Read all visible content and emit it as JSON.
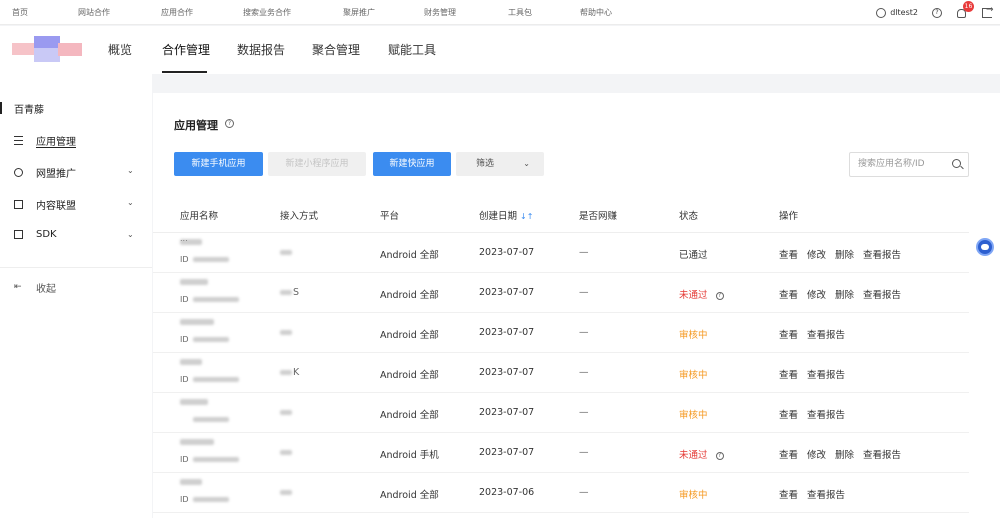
{
  "topnav": [
    "首页",
    "网站合作",
    "应用合作",
    "搜索业务合作",
    "聚屏推广",
    "财务管理",
    "工具包",
    "帮助中心"
  ],
  "user": {
    "name": "dltest2",
    "badge": "16"
  },
  "subnav": [
    "概览",
    "合作管理",
    "数据报告",
    "聚合管理",
    "赋能工具"
  ],
  "sidebar": {
    "title": "百青藤",
    "items": [
      {
        "label": "应用管理",
        "icon": "list-icon"
      },
      {
        "label": "网盟推广",
        "icon": "target-icon"
      },
      {
        "label": "内容联盟",
        "icon": "image-icon"
      },
      {
        "label": "SDK",
        "icon": "sdk-icon"
      }
    ],
    "collapse": "收起"
  },
  "main": {
    "heading": "应用管理",
    "buttons": {
      "new_mobile": "新建手机应用",
      "new_miniprogram": "新建小程序应用",
      "new_quickapp": "新建快应用",
      "filter": "筛选"
    },
    "search_placeholder": "搜索应用名称/ID",
    "columns": [
      "应用名称",
      "接入方式",
      "平台",
      "创建日期",
      "是否网赚",
      "状态",
      "操作"
    ],
    "rows": [
      {
        "name": "...",
        "id": "ID",
        "access": "",
        "platform": "Android 全部",
        "date": "2023-07-07",
        "earn": "—",
        "status": "已通过",
        "status_kind": "ok",
        "ops": [
          "查看",
          "修改",
          "删除",
          "查看报告"
        ]
      },
      {
        "name": "",
        "id": "ID",
        "access": "S",
        "platform": "Android 全部",
        "date": "2023-07-07",
        "earn": "—",
        "status": "未通过",
        "status_kind": "no",
        "ops": [
          "查看",
          "修改",
          "删除",
          "查看报告"
        ]
      },
      {
        "name": "",
        "id": "ID",
        "access": "",
        "platform": "Android 全部",
        "date": "2023-07-07",
        "earn": "—",
        "status": "审核中",
        "status_kind": "wait",
        "ops": [
          "查看",
          "查看报告"
        ]
      },
      {
        "name": "",
        "id": "ID",
        "access": "K",
        "platform": "Android 全部",
        "date": "2023-07-07",
        "earn": "—",
        "status": "审核中",
        "status_kind": "wait",
        "ops": [
          "查看",
          "查看报告"
        ]
      },
      {
        "name": "",
        "id": "",
        "access": "",
        "platform": "Android 全部",
        "date": "2023-07-07",
        "earn": "—",
        "status": "审核中",
        "status_kind": "wait",
        "ops": [
          "查看",
          "查看报告"
        ]
      },
      {
        "name": "",
        "id": "ID",
        "access": "",
        "platform": "Android 手机",
        "date": "2023-07-07",
        "earn": "—",
        "status": "未通过",
        "status_kind": "no",
        "ops": [
          "查看",
          "修改",
          "删除",
          "查看报告"
        ]
      },
      {
        "name": "",
        "id": "ID",
        "access": "",
        "platform": "Android 全部",
        "date": "2023-07-06",
        "earn": "—",
        "status": "审核中",
        "status_kind": "wait",
        "ops": [
          "查看",
          "查看报告"
        ]
      }
    ]
  },
  "colors": {
    "primary": "#3b8cf0",
    "danger": "#e53935",
    "warning": "#f59a23"
  }
}
